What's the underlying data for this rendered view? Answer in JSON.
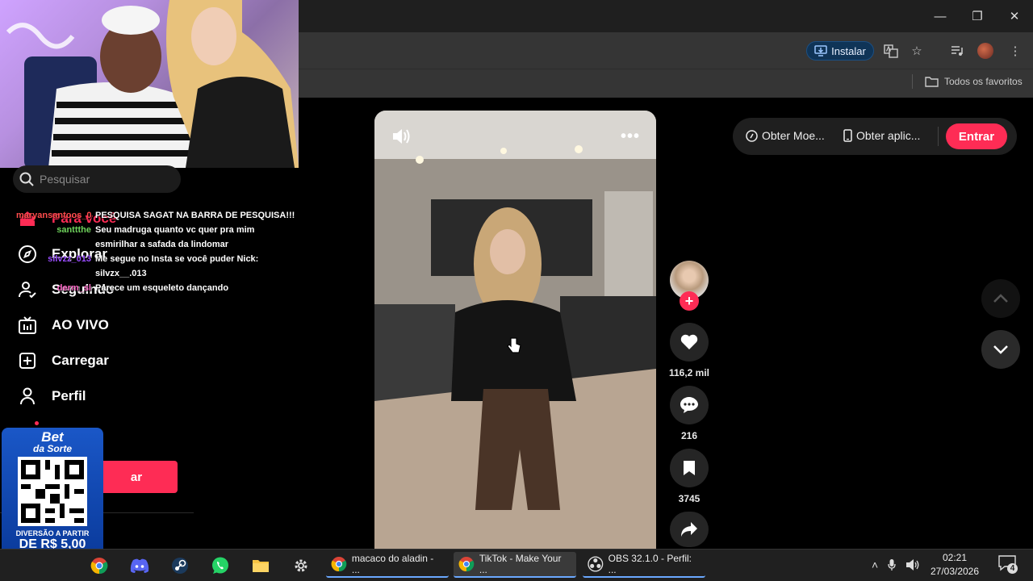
{
  "browser": {
    "install_label": "Instalar",
    "all_favorites_label": "Todos os favoritos"
  },
  "sidebar": {
    "search_placeholder": "Pesquisar",
    "nav": [
      {
        "label": "Para você",
        "icon": "home-icon"
      },
      {
        "label": "Explorar",
        "icon": "compass-icon"
      },
      {
        "label": "Seguindo",
        "icon": "following-icon"
      },
      {
        "label": "AO VIVO",
        "icon": "live-icon"
      },
      {
        "label": "Carregar",
        "icon": "upload-icon"
      },
      {
        "label": "Perfil",
        "icon": "profile-icon"
      }
    ],
    "login_label": "ar"
  },
  "chat": [
    {
      "user": "maryansantoos_0",
      "user_color": "#ff4d4d",
      "lines": [
        "PESQUISA SAGAT NA BARRA DE PESQUISA!!!"
      ]
    },
    {
      "user": "santtthe",
      "user_color": "#6fd35c",
      "lines": [
        "Seu madruga quanto vc quer pra mim",
        "esmirilhar a safada da lindomar"
      ]
    },
    {
      "user": "silvzz_013",
      "user_color": "#9a4dff",
      "lines": [
        "Me segue no Insta se você puder Nick:",
        "silvzx__.013"
      ]
    },
    {
      "user": "derm_sl",
      "user_color": "#ff69c8",
      "lines": [
        "Parece um esqueleto dançando"
      ]
    }
  ],
  "ad": {
    "brand_line1": "Bet",
    "brand_line2": "da Sorte",
    "tagline": "DIVERSÃO A PARTIR",
    "price": "DE R$ 5,00"
  },
  "video": {
    "likes": "116,2 mil",
    "comments": "216",
    "saves": "3745"
  },
  "header_actions": {
    "coins_label": "Obter Moe...",
    "app_label": "Obter aplic...",
    "login_label": "Entrar"
  },
  "taskbar": {
    "windows": [
      {
        "label": "macaco do aladin - ...",
        "icon": "chrome-icon"
      },
      {
        "label": "TikTok - Make Your ...",
        "icon": "chrome-icon"
      },
      {
        "label": "OBS 32.1.0 - Perfil: ...",
        "icon": "obs-icon"
      }
    ],
    "time": "02:21",
    "date": "27/03/2026",
    "notifications": "4"
  }
}
